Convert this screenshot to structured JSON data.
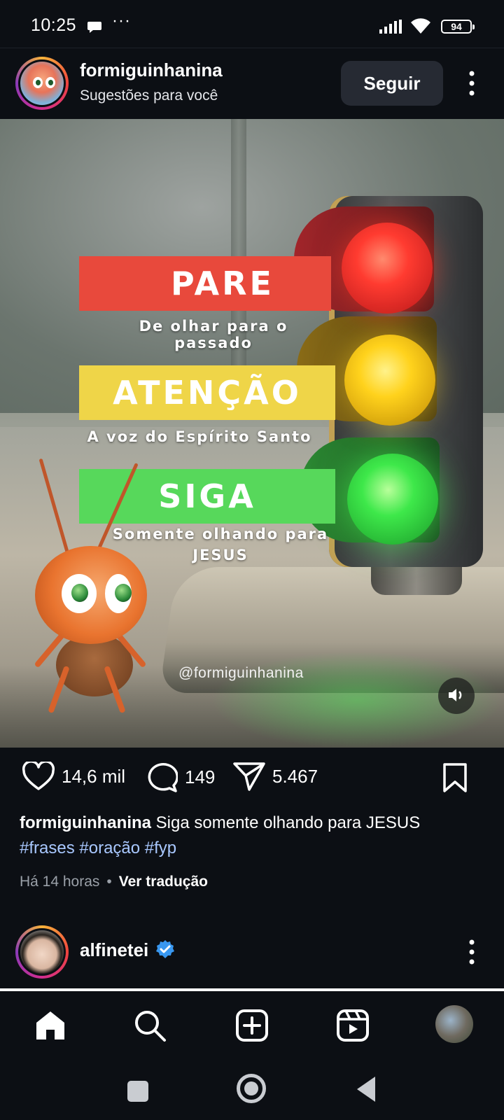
{
  "status_bar": {
    "time": "10:25",
    "more_dots": "···",
    "battery": "94"
  },
  "post": {
    "username": "formiguinhanina",
    "subtitle": "Sugestões para você",
    "follow_label": "Seguir",
    "image": {
      "pare": "PARE",
      "pare_caption": "De olhar para o passado",
      "atencao": "ATENÇÃO",
      "atencao_caption": "A voz do Espírito Santo",
      "siga": "SIGA",
      "siga_caption": "Somente olhando para JESUS",
      "watermark": "@formiguinhanina"
    },
    "likes": "14,6 mil",
    "comments": "149",
    "shares": "5.467",
    "caption_user": "formiguinhanina",
    "caption_text": "Siga somente olhando para JESUS",
    "hashtags": [
      "#frases",
      "#oração",
      "#fyp"
    ],
    "time_ago": "Há 14 horas",
    "separator": "•",
    "translate_label": "Ver tradução"
  },
  "next_post": {
    "username": "alfinetei"
  },
  "colors": {
    "background": "#0c0f14",
    "hashtag": "#a9c8ff",
    "verified": "#3897f0",
    "pare": "#e8493c",
    "atencao": "#efd548",
    "siga": "#57d85b"
  },
  "icons": {
    "like": "heart-icon",
    "comment": "comment-icon",
    "share": "send-icon",
    "save": "bookmark-icon",
    "home": "home-icon",
    "search": "search-icon",
    "create": "plus-square-icon",
    "reels": "reels-icon"
  }
}
